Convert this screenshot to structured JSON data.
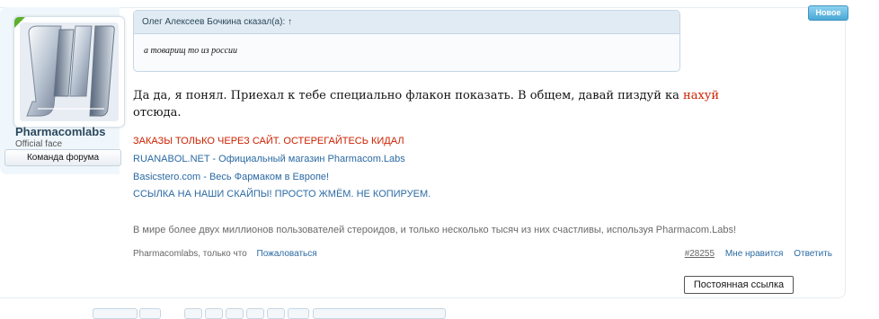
{
  "post": {
    "new_badge": "Новое",
    "author": {
      "name": "Pharmacomlabs",
      "title": "Official face",
      "banner": "Команда форума"
    },
    "quote": {
      "header": "Олег Алексеев Бочкина сказал(а): ↑",
      "text": "а товарищ то из россии"
    },
    "message": {
      "text": "Да да, я понял. Приехал к тебе специально флакон показать. В общем, давай пиздуй ка",
      "highlight": "нахуй",
      "tail": "отсюда."
    },
    "signature": {
      "line1": "ЗАКАЗЫ ТОЛЬКО ЧЕРЕЗ САЙТ. ОСТЕРЕГАЙТЕСЬ КИДАЛ",
      "line2": "RUANABOL.NET - Официальный магазин Pharmacom.Labs",
      "line3": "Basicstero.com - Весь Фармаком в Европе!",
      "line4": "ССЫЛКА НА НАШИ СКАЙПЫ! ПРОСТО ЖМЁМ. НЕ КОПИРУЕМ.",
      "line5": "В мире более двух миллионов пользователей стероидов, и только несколько тысяч из них счастливы, используя Pharmacom.Labs!"
    },
    "meta": {
      "author_time": "Pharmacomlabs, только что",
      "report": "Пожаловаться"
    },
    "controls": {
      "post_number": "#28255",
      "like": "Мне нравится",
      "reply": "Ответить"
    },
    "permalink": "Постоянная ссылка"
  },
  "colors": {
    "link": "#2b6aa3",
    "warning_red": "#cc2200",
    "sidebar_bg": "#f0f7fc",
    "quote_header_bg": "#e1ebf3",
    "online_indicator": "#5cb02c",
    "new_badge": "#4aa8d6"
  }
}
